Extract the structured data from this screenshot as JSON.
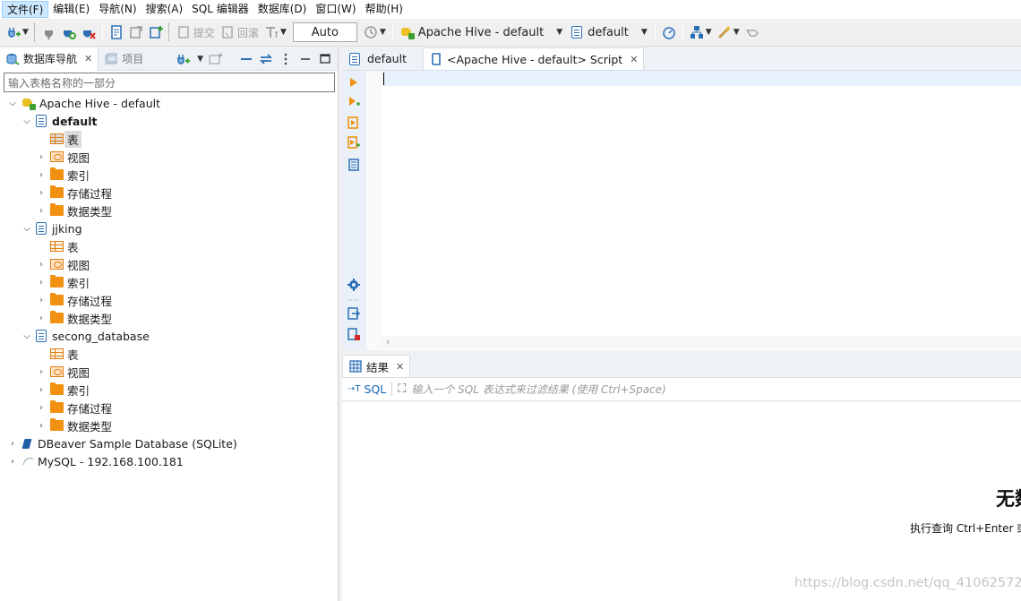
{
  "menu": [
    "文件(F)",
    "编辑(E)",
    "导航(N)",
    "搜索(A)",
    "SQL 编辑器",
    "数据库(D)",
    "窗口(W)",
    "帮助(H)"
  ],
  "toolbar": {
    "commit_label": "提交",
    "rollback_label": "回滚",
    "transaction_mode": "Auto",
    "datasource": "Apache Hive - default",
    "schema": "default"
  },
  "navigator": {
    "tab_label": "数据库导航",
    "projects_tab_label": "项目",
    "filter_placeholder": "输入表格名称的一部分",
    "connection": "Apache Hive - default",
    "databases": [
      {
        "name": "default",
        "children": [
          "表",
          "视图",
          "索引",
          "存储过程",
          "数据类型"
        ]
      },
      {
        "name": "jjking",
        "children": [
          "表",
          "视图",
          "索引",
          "存储过程",
          "数据类型"
        ]
      },
      {
        "name": "secong_database",
        "children": [
          "表",
          "视图",
          "索引",
          "存储过程",
          "数据类型"
        ]
      }
    ],
    "other_connections": [
      "DBeaver Sample Database (SQLite)",
      "MySQL - 192.168.100.181"
    ]
  },
  "editor": {
    "tabs": [
      "default",
      "<Apache Hive - default> Script"
    ]
  },
  "results": {
    "tab_label": "结果",
    "sql_label": "SQL",
    "filter_placeholder": "输入一个 SQL 表达式来过滤结果 (使用 Ctrl+Space)",
    "empty_title": "无数",
    "empty_hint": "执行查询 Ctrl+Enter 或"
  },
  "watermark": "https://blog.csdn.net/qq_41062572",
  "colors": {
    "accent": "#2a6fb5",
    "folder": "#f29111",
    "selection": "#dcdcdc"
  }
}
